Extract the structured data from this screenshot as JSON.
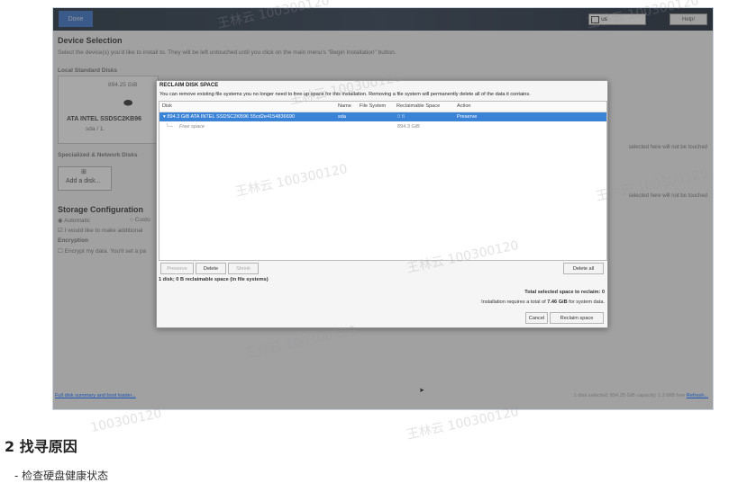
{
  "window": {
    "done_label": "Done",
    "keyboard_layout": "us",
    "help_label": "Help!"
  },
  "background": {
    "device_selection_title": "Device Selection",
    "device_selection_desc": "Select the device(s) you'd like to install to. They will be left untouched until you click on the main menu's \"Begin Installation\" button.",
    "local_disks_label": "Local Standard Disks",
    "disk_size": "894.25 GiB",
    "disk_name": "ATA INTEL SSDSC2KB96",
    "disk_sub": "sda   /   1.",
    "specialized_label": "Specialized & Network Disks",
    "add_disk_label": "Add a disk...",
    "storage_config_title": "Storage Configuration",
    "automatic_label": "Automatic",
    "custom_label": "Custo",
    "additional_space_label": "I would like to make additional",
    "encryption_label": "Encryption",
    "encrypt_label": "Encrypt my data. You'll set a pa",
    "untouched_note_1": "selected here will not be touched",
    "untouched_note_2": "selected here will not be touched"
  },
  "dialog": {
    "title": "RECLAIM DISK SPACE",
    "description": "You can remove existing file systems you no longer need to free up space for this installation.  Removing a file system will permanently delete all of the data it contains.",
    "columns": {
      "disk": "Disk",
      "name": "Name",
      "file_system": "File System",
      "reclaimable": "Reclaimable Space",
      "action": "Action"
    },
    "rows": [
      {
        "disk": "▾ 894.3 GiB ATA INTEL SSDSC2KB96 55cd2e4154836690",
        "name": "sda",
        "file_system": "",
        "reclaimable": "0 B",
        "action": "Preserve"
      },
      {
        "disk": "Free space",
        "name": "",
        "file_system": "",
        "reclaimable": "894.3 GiB",
        "action": ""
      }
    ],
    "preserve_label": "Preserve",
    "delete_label": "Delete",
    "shrink_label": "Shrink",
    "delete_all_label": "Delete all",
    "summary": "1 disk; 0 B reclaimable space (in file systems)",
    "total_selected": "Total selected space to reclaim: 0",
    "requires_prefix": "Installation requires a total of",
    "requires_value": "7.46 GiB",
    "requires_suffix": "for system data.",
    "cancel_label": "Cancel",
    "reclaim_label": "Reclaim space"
  },
  "footer": {
    "summary_link": "Full disk summary and boot loader...",
    "status": "1 disk selected; 894.25 GiB capacity; 1.3 MiB free",
    "refresh_label": "Refresh..."
  },
  "watermarks": [
    "王林云 100300120",
    "王林云 100300120",
    "王林云 100300120",
    "王林云 100300120",
    "王林云 100300120",
    "王林云 100300120",
    "王林云 100300120",
    "王林云 100300120",
    "100300120"
  ],
  "article": {
    "section_heading": "2 找寻原因",
    "next_line": "- 检查硬盘健康状态"
  }
}
